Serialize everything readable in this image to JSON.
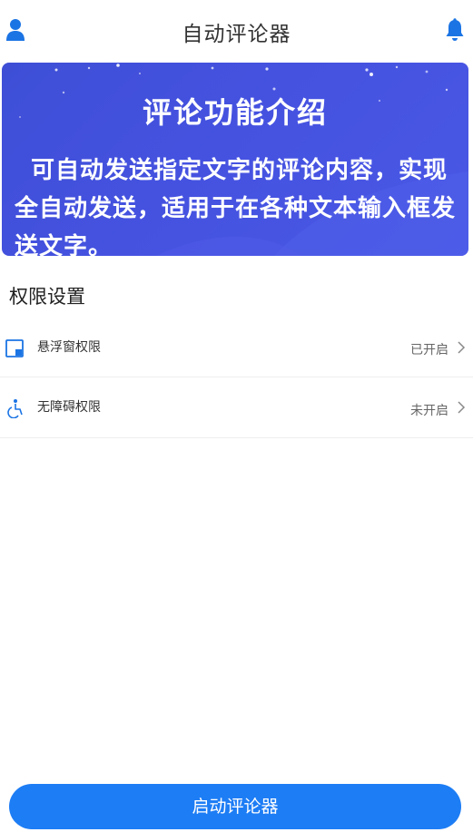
{
  "header": {
    "title": "自动评论器",
    "left_icon": "user-icon",
    "right_icon": "bell-icon"
  },
  "banner": {
    "title": "评论功能介绍",
    "description": "可自动发送指定文字的评论内容，实现全自动发送，适用于在各种文本输入框发送文字。"
  },
  "permissions": {
    "section_title": "权限设置",
    "items": [
      {
        "label": "悬浮窗权限",
        "status": "已开启",
        "icon": "floating-window-icon"
      },
      {
        "label": "无障碍权限",
        "status": "未开启",
        "icon": "accessibility-icon"
      }
    ]
  },
  "footer": {
    "start_label": "启动评论器"
  },
  "colors": {
    "accent": "#1d7df5",
    "banner": "#4552e0",
    "icon_blue": "#1b74e4"
  }
}
